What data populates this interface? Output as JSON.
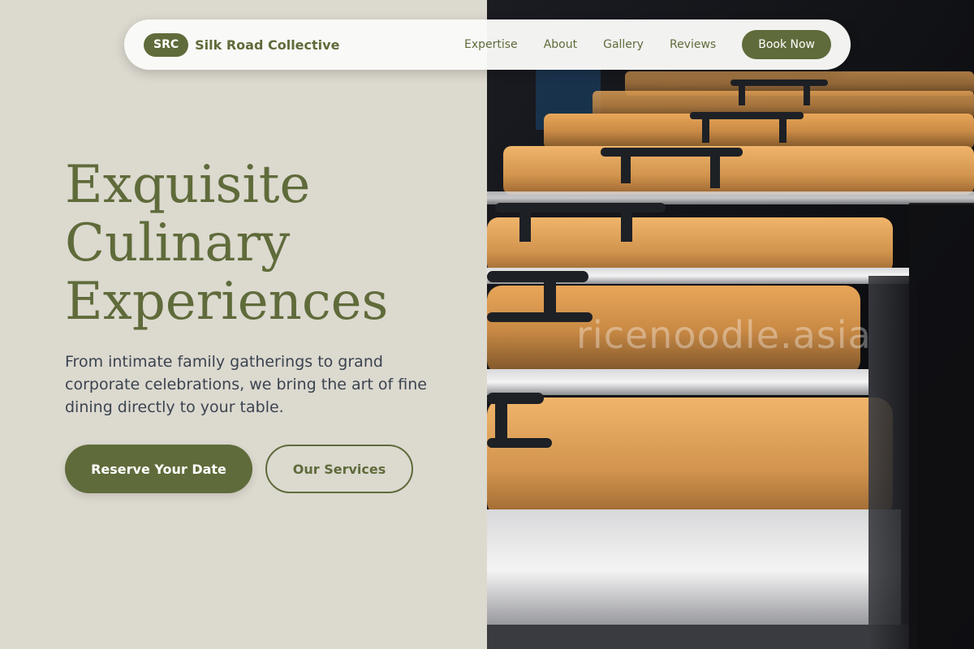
{
  "nav": {
    "brand_badge": "SRC",
    "brand_name": "Silk Road Collective",
    "links": [
      "Expertise",
      "About",
      "Gallery",
      "Reviews"
    ],
    "cta": "Book Now"
  },
  "hero": {
    "title_lines": [
      "Exquisite",
      "Culinary",
      "Experiences"
    ],
    "subtitle": "From intimate family gatherings to grand corporate celebrations, we bring the art of fine dining directly to your table.",
    "primary_button": "Reserve Your Date",
    "secondary_button": "Our Services"
  },
  "image": {
    "description_icon": "chafing-dishes-image",
    "watermark": "ricenoodle.asia"
  },
  "colors": {
    "accent": "#5f6b3a",
    "background": "#dcd9cf",
    "text_body": "#3b4450"
  }
}
